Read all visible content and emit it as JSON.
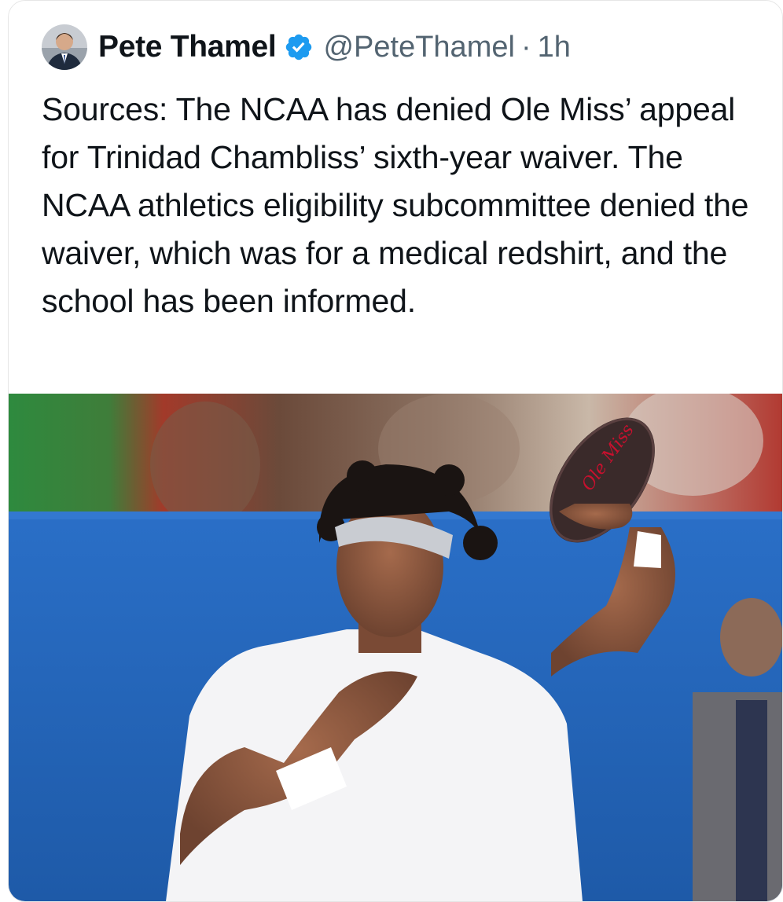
{
  "tweet": {
    "author_name": "Pete Thamel",
    "handle": "@PeteThamel",
    "separator": "·",
    "time": "1h",
    "text": "Sources: The NCAA has denied Ole Miss’ appeal for Trinidad Chambliss’ sixth-year waiver. The NCAA athletics eligibility subcommittee denied the waiver, which was for a medical redshirt, and the school has been informed."
  },
  "icons": {
    "verified": "verified-badge-icon"
  },
  "colors": {
    "verified": "#1d9bf0",
    "text": "#0f1419",
    "secondary": "#536471",
    "border": "#e6e6e6"
  },
  "media": {
    "ball_text": "Ole Miss"
  }
}
